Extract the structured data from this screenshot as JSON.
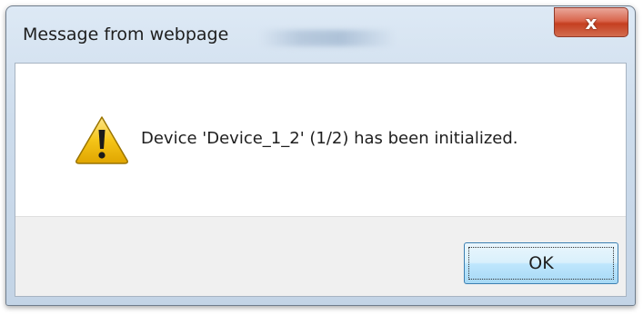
{
  "window": {
    "title": "Message from webpage",
    "close_glyph": "x"
  },
  "message": {
    "text": "Device 'Device_1_2' (1/2) has been initialized.",
    "icon": "warning-icon"
  },
  "buttons": {
    "ok_label": "OK"
  },
  "colors": {
    "titlebar": "#cddcec",
    "close_button": "#c53f20",
    "button_area": "#f0f0f0",
    "ok_border": "#3c7fb1",
    "warning_fill": "#f5c518"
  }
}
